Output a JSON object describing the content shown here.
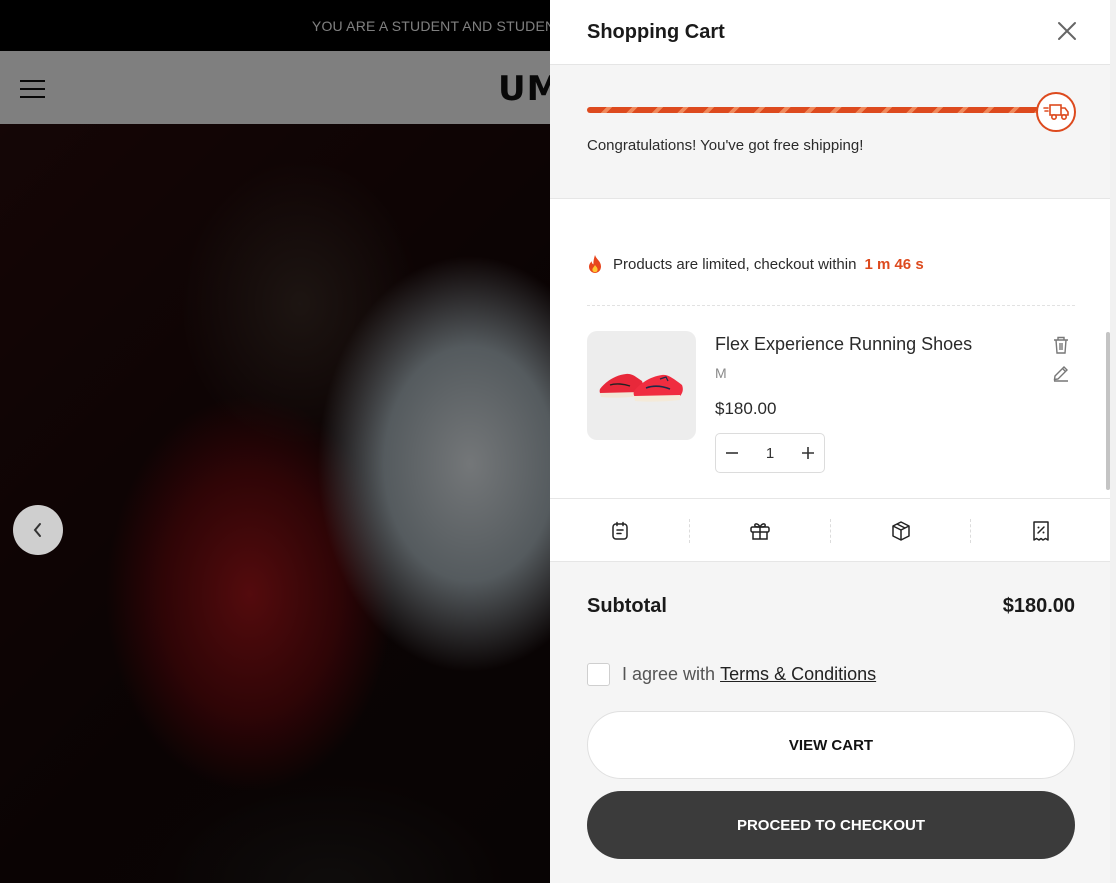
{
  "announcement": {
    "text": "YOU ARE A STUDENT AND STUDENT"
  },
  "header": {
    "logo_text": "UM"
  },
  "hero": {
    "slider_prev_icon": "chevron-left-icon"
  },
  "cart": {
    "title": "Shopping Cart",
    "close_icon": "close-icon",
    "shipping": {
      "progress_fraction": 1.0,
      "message": "Congratulations! You've got free shipping!",
      "icon": "delivery-truck-icon",
      "accent_color": "#dd4a1e"
    },
    "urgency": {
      "icon": "fire-icon",
      "text": "Products are limited, checkout within",
      "timer": "1 m 46 s"
    },
    "items": [
      {
        "name": "Flex Experience Running Shoes",
        "variant": "M",
        "price": "$180.00",
        "quantity": "1",
        "image_icon": "red-running-shoes-image",
        "actions": [
          "trash-icon",
          "edit-icon"
        ]
      }
    ],
    "tools": [
      "order-note-icon",
      "gift-icon",
      "shipping-box-icon",
      "coupon-icon"
    ],
    "subtotal_label": "Subtotal",
    "subtotal_value": "$180.00",
    "agree_text": "I agree with",
    "terms_link": "Terms & Conditions",
    "view_cart_label": "VIEW CART",
    "checkout_label": "PROCEED TO CHECKOUT",
    "checkout_color": "#3b3b3b"
  }
}
